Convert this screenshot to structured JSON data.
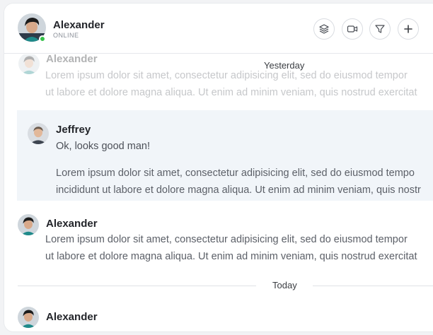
{
  "header": {
    "name": "Alexander",
    "status": "ONLINE",
    "actions": [
      {
        "icon": "layers-icon"
      },
      {
        "icon": "video-icon"
      },
      {
        "icon": "filter-icon"
      },
      {
        "icon": "plus-icon"
      }
    ]
  },
  "separators": {
    "yesterday": "Yesterday",
    "today": "Today"
  },
  "messages": {
    "faded_sender": "Alexander",
    "faded_line1": "Lorem ipsum dolor sit amet, consectetur adipisicing elit, sed do eiusmod tempor",
    "faded_line2": "ut labore et dolore magna aliqua. Ut enim ad minim veniam, quis nostrud exercitat",
    "jeffrey_sender": "Jeffrey",
    "jeffrey_short": "Ok, looks good man!",
    "jeffrey_line1": "Lorem ipsum dolor sit amet, consectetur adipisicing elit, sed do eiusmod tempo",
    "jeffrey_line2": "incididunt ut labore et dolore magna aliqua. Ut enim ad minim veniam, quis nostr",
    "alex_sender": "Alexander",
    "alex_line1": "Lorem ipsum dolor sit amet, consectetur adipisicing elit, sed do eiusmod tempor",
    "alex_line2": "ut labore et dolore magna aliqua. Ut enim ad minim veniam, quis nostrud exercitat",
    "today_sender": "Alexander"
  },
  "colors": {
    "online": "#36c24a",
    "highlight": "#f1f5f9"
  }
}
